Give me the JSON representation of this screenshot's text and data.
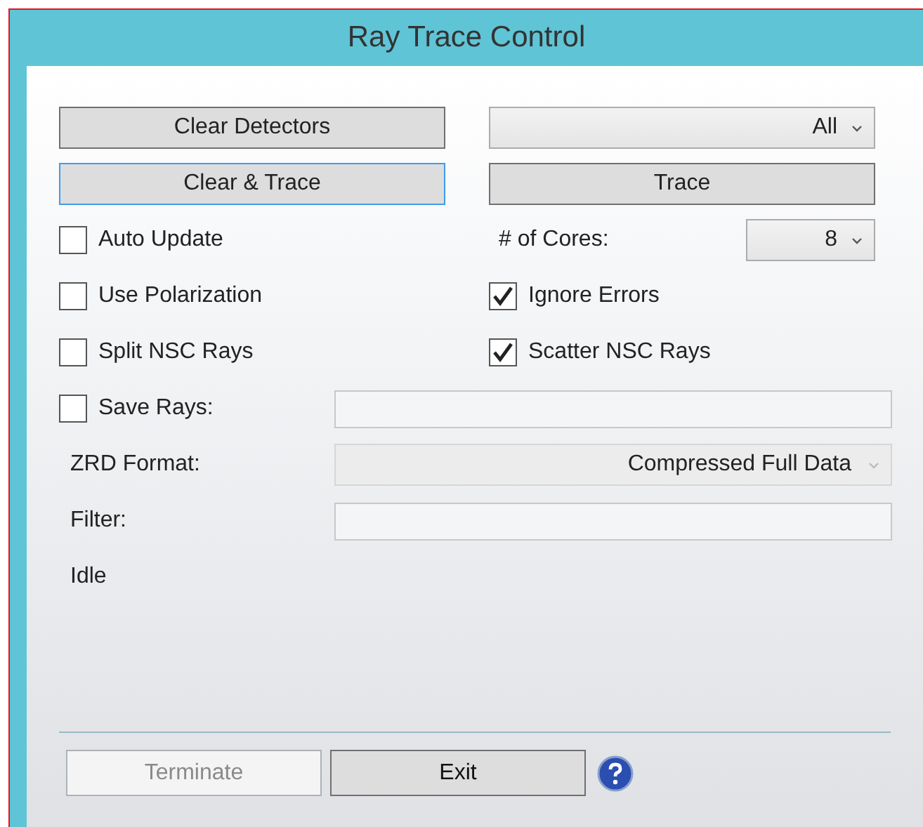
{
  "window": {
    "title": "Ray Trace Control"
  },
  "clear_detectors_button": {
    "label": "Clear Detectors"
  },
  "detector_dropdown": {
    "value": "All"
  },
  "trace_buttons": [
    {
      "label": "Clear & Trace",
      "focused": true
    },
    {
      "label": "Trace",
      "focused": false
    }
  ],
  "left_options": [
    {
      "label": "Auto Update",
      "checked": false
    },
    {
      "label": "Use Polarization",
      "checked": false
    },
    {
      "label": "Split NSC Rays",
      "checked": false
    }
  ],
  "cores": {
    "label": "# of Cores:",
    "value": "8"
  },
  "right_options": [
    {
      "label": "Ignore Errors",
      "checked": true
    },
    {
      "label": "Scatter NSC Rays",
      "checked": true
    }
  ],
  "save_rays": {
    "label": "Save Rays:",
    "checked": false
  },
  "zrd_format": {
    "label": "ZRD Format:",
    "value": "Compressed Full Data",
    "disabled": true
  },
  "filter": {
    "label": "Filter:"
  },
  "status": "Idle",
  "footer_buttons": [
    {
      "label": "Terminate",
      "disabled": true
    },
    {
      "label": "Exit",
      "disabled": false
    }
  ]
}
